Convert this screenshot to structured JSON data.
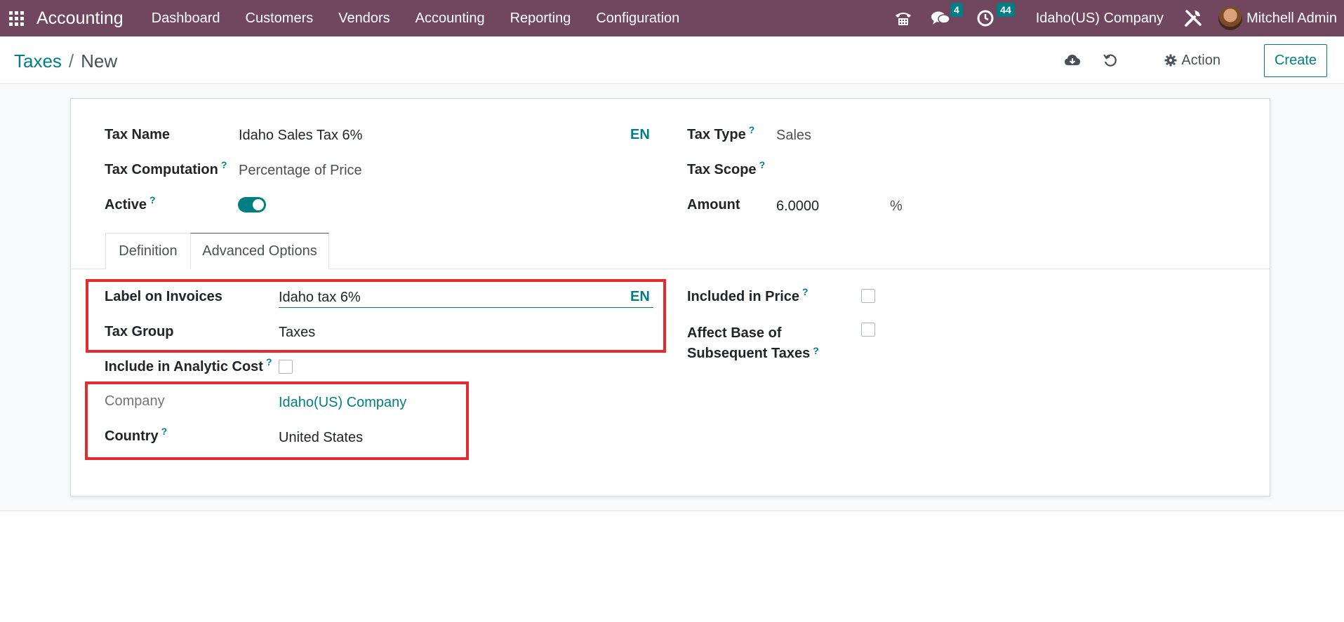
{
  "navbar": {
    "app_name": "Accounting",
    "menu": [
      "Dashboard",
      "Customers",
      "Vendors",
      "Accounting",
      "Reporting",
      "Configuration"
    ],
    "messages_count": "4",
    "activities_count": "44",
    "company": "Idaho(US) Company",
    "user": "Mitchell Admin",
    "icons": [
      "apps-icon",
      "phone-icon",
      "chat-icon",
      "clock-icon",
      "tools-icon"
    ]
  },
  "breadcrumb": {
    "parent": "Taxes",
    "separator": "/",
    "current": "New"
  },
  "control": {
    "action_label": "Action",
    "create_label": "Create"
  },
  "form": {
    "tax_name_label": "Tax Name",
    "tax_name_value": "Idaho Sales Tax 6%",
    "lang_label": "EN",
    "tax_computation_label": "Tax Computation",
    "tax_computation_value": "Percentage of Price",
    "active_label": "Active",
    "active_value": true,
    "tax_type_label": "Tax Type",
    "tax_type_value": "Sales",
    "tax_scope_label": "Tax Scope",
    "amount_label": "Amount",
    "amount_value": "6.0000",
    "amount_unit": "%",
    "help_mark": "?"
  },
  "tabs": [
    {
      "label": "Definition",
      "active": false
    },
    {
      "label": "Advanced Options",
      "active": true
    }
  ],
  "advanced": {
    "label_on_invoices_label": "Label on Invoices",
    "label_on_invoices_value": "Idaho tax 6%",
    "tax_group_label": "Tax Group",
    "tax_group_value": "Taxes",
    "include_analytic_label": "Include in Analytic Cost",
    "include_analytic_checked": false,
    "company_label": "Company",
    "company_value": "Idaho(US) Company",
    "country_label": "Country",
    "country_value": "United States",
    "included_in_price_label": "Included in Price",
    "included_in_price_checked": false,
    "affect_base_label_line1": "Affect Base of",
    "affect_base_label_line2": "Subsequent Taxes",
    "affect_base_checked": false
  },
  "colors": {
    "navbar": "#71475f",
    "accent": "#017e84",
    "highlight": "#e32a2f"
  }
}
